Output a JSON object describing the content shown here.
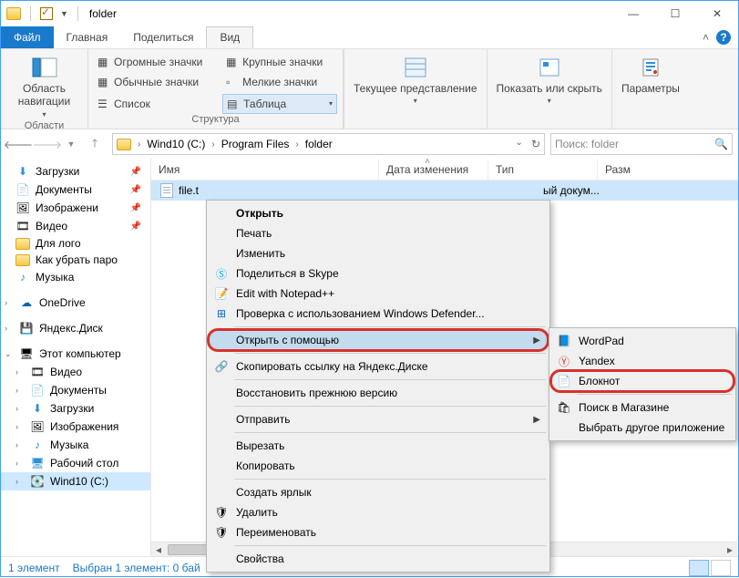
{
  "window": {
    "title": "folder"
  },
  "tabs": {
    "file": "Файл",
    "home": "Главная",
    "share": "Поделиться",
    "view": "Вид"
  },
  "ribbon": {
    "nav": {
      "label": "Область навигации",
      "group": "Области"
    },
    "layouts": {
      "huge": "Огромные значки",
      "large": "Крупные значки",
      "normal": "Обычные значки",
      "small": "Мелкие значки",
      "list": "Список",
      "table": "Таблица",
      "group": "Структура"
    },
    "current": "Текущее представление",
    "show": "Показать или скрыть",
    "options": "Параметры"
  },
  "breadcrumb": {
    "drive": "Wind10 (C:)",
    "p1": "Program Files",
    "p2": "folder"
  },
  "search": {
    "placeholder": "Поиск: folder"
  },
  "columns": {
    "name": "Имя",
    "date": "Дата изменения",
    "type": "Тип",
    "size": "Разм"
  },
  "file": {
    "name": "file.t",
    "type_trunc": "ый докум..."
  },
  "sidebar": {
    "downloads": "Загрузки",
    "documents": "Документы",
    "images": "Изображени",
    "video": "Видео",
    "logo": "Для лого",
    "howto": "Как убрать паро",
    "music": "Музыка",
    "onedrive": "OneDrive",
    "yadisk": "Яндекс.Диск",
    "thispc": "Этот компьютер",
    "video2": "Видео",
    "documents2": "Документы",
    "downloads2": "Загрузки",
    "images2": "Изображения",
    "music2": "Музыка",
    "desktop": "Рабочий стол",
    "drive": "Wind10 (C:)"
  },
  "ctx": {
    "open": "Открыть",
    "print": "Печать",
    "edit": "Изменить",
    "skype": "Поделиться в Skype",
    "npp": "Edit with Notepad++",
    "defender": "Проверка с использованием Windows Defender...",
    "openwith": "Открыть с помощью",
    "yalink": "Скопировать ссылку на Яндекс.Диске",
    "restore": "Восстановить прежнюю версию",
    "sendto": "Отправить",
    "cut": "Вырезать",
    "copy": "Копировать",
    "shortcut": "Создать ярлык",
    "delete": "Удалить",
    "rename": "Переименовать",
    "props": "Свойства"
  },
  "submenu": {
    "wordpad": "WordPad",
    "yandex": "Yandex",
    "notepad": "Блокнот",
    "store": "Поиск в Магазине",
    "other": "Выбрать другое приложение"
  },
  "status": {
    "count": "1 элемент",
    "sel": "Выбран 1 элемент: 0 бай"
  }
}
